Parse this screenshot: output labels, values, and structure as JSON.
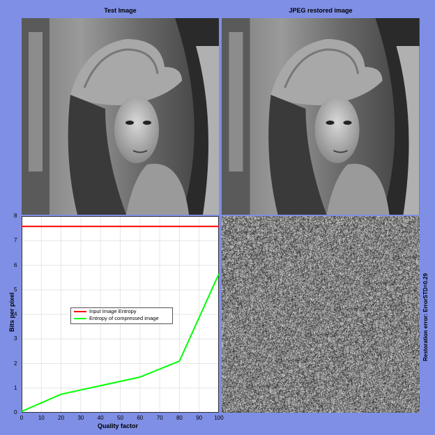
{
  "panels": {
    "left_title": "Test Image",
    "right_title": "JPEG restored image",
    "error_label": "Restoration error: ErrorSTD=0.29"
  },
  "colors": {
    "background": "#7f8fe6",
    "input_entropy": "#ff0000",
    "compressed_entropy": "#00ff00"
  },
  "chart_data": {
    "type": "line",
    "xlabel": "Quality factor",
    "ylabel": "Bits per pixel",
    "xlim": [
      0,
      100
    ],
    "ylim": [
      0,
      8
    ],
    "xticks": [
      "0",
      "10",
      "20",
      "30",
      "40",
      "50",
      "60",
      "70",
      "80",
      "90",
      "100"
    ],
    "yticks": [
      "0",
      "1",
      "2",
      "3",
      "4",
      "5",
      "6",
      "7",
      "8"
    ],
    "grid": true,
    "legend_position": "center",
    "series": [
      {
        "name": "Input Image Entropy",
        "color": "#ff0000",
        "x": [
          0,
          100
        ],
        "y": [
          7.58,
          7.58
        ]
      },
      {
        "name": "Entropy of compressed image",
        "color": "#00ff00",
        "x": [
          0,
          20,
          40,
          60,
          80,
          100
        ],
        "y": [
          0.05,
          0.75,
          1.1,
          1.45,
          2.1,
          5.65
        ]
      }
    ]
  }
}
